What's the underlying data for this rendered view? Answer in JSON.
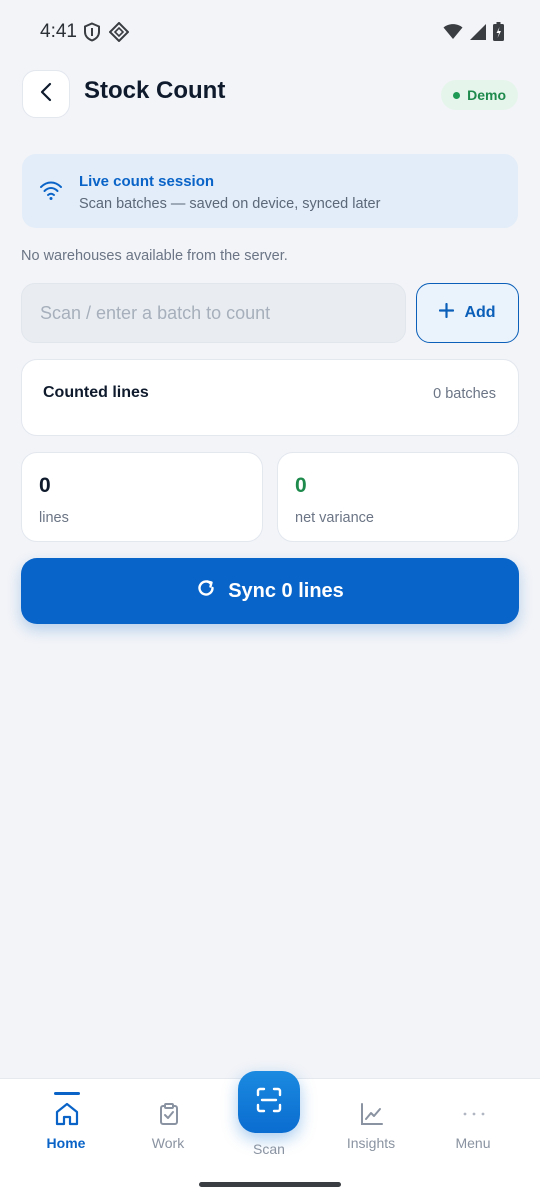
{
  "status_bar": {
    "time": "4:41",
    "icons": [
      "shield-icon",
      "diamond-grid-icon",
      "wifi-icon",
      "signal-icon",
      "battery-icon"
    ]
  },
  "header": {
    "title": "Stock Count",
    "badge": "Demo",
    "badge_color": "#1e8a4c"
  },
  "session": {
    "title": "Live count session",
    "subtitle": "Scan batches — saved on device, synced later"
  },
  "warehouse_note": "No warehouses available from the server.",
  "scan": {
    "placeholder": "Scan / enter a batch to count",
    "value": "",
    "add_label": "Add"
  },
  "counted": {
    "title": "Counted lines",
    "count_label": "0 batches"
  },
  "stats": {
    "lines_value": "0",
    "lines_label": "lines",
    "variance_value": "0",
    "variance_label": "net variance",
    "variance_color": "#1e8a4c"
  },
  "sync": {
    "label": "Sync 0 lines"
  },
  "nav": {
    "items": [
      {
        "label": "Home",
        "icon": "home-icon",
        "active": true
      },
      {
        "label": "Work",
        "icon": "clipboard-check-icon",
        "active": false
      },
      {
        "label": "Scan",
        "icon": "scan-icon",
        "active": false
      },
      {
        "label": "Insights",
        "icon": "line-chart-icon",
        "active": false
      },
      {
        "label": "Menu",
        "icon": "more-dots-icon",
        "active": false
      }
    ]
  },
  "colors": {
    "primary": "#0864c8",
    "background": "#f2f4f8",
    "session_bg": "#e2edf9"
  }
}
